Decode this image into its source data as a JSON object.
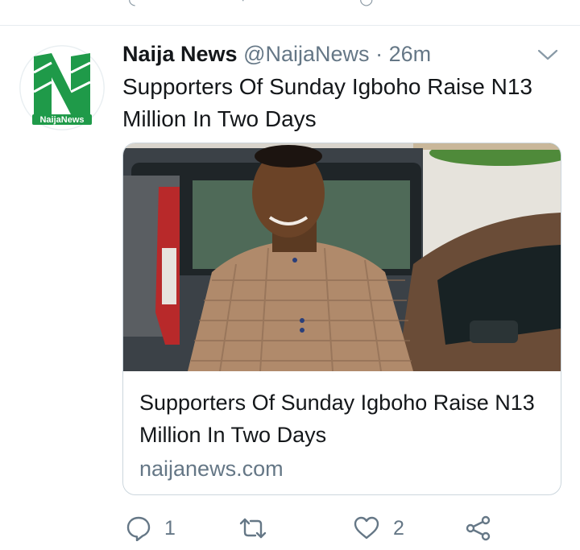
{
  "tweet": {
    "display_name": "Naija News",
    "handle": "@NaijaNews",
    "separator": "·",
    "time": "26m",
    "text": "Supporters Of Sunday Igboho Raise N13 Million In Two Days",
    "avatar_logo_text": "NaijaNews",
    "card": {
      "title": "Supporters Of Sunday Igboho Raise N13 Million In Two Days",
      "domain": "naijanews.com"
    },
    "actions": {
      "reply_count": "1",
      "retweet_count": "",
      "like_count": "2"
    }
  },
  "icons": {
    "reply": "speech-bubble-icon",
    "retweet": "retweet-icon",
    "like": "heart-icon",
    "share": "share-icon",
    "menu": "chevron-down-icon"
  },
  "colors": {
    "text_primary": "#14171a",
    "text_secondary": "#657786",
    "logo_green": "#1f9a49",
    "divider": "#e6ecf0"
  }
}
